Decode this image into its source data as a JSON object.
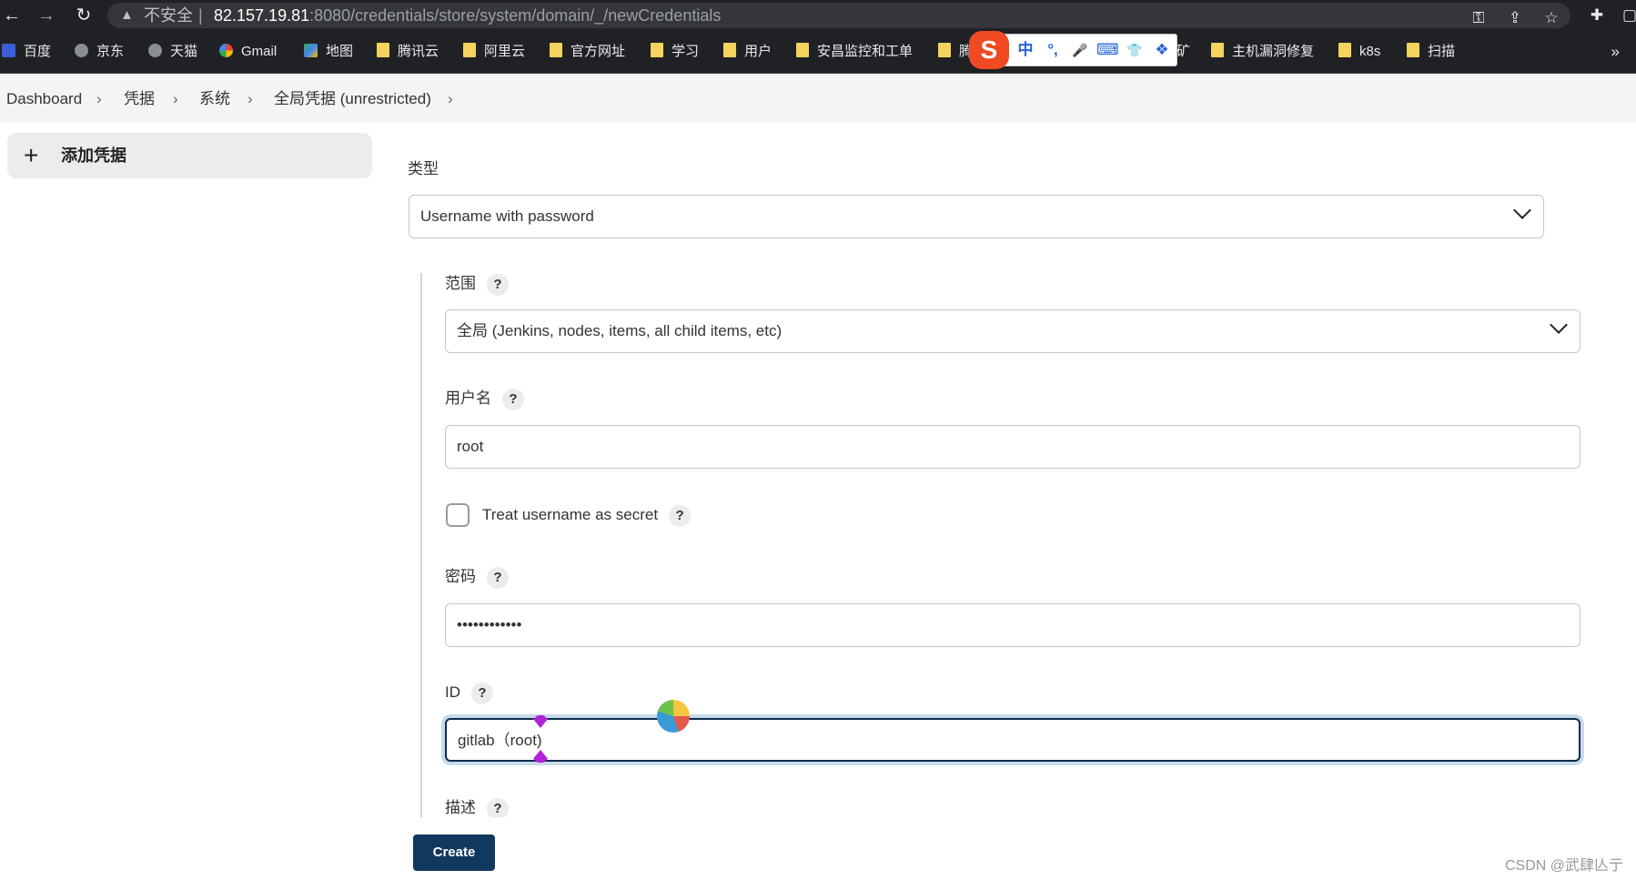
{
  "browser": {
    "url_warning": "不安全",
    "url_separator": "|",
    "url_host": "82.157.19.81",
    "url_path": ":8080/credentials/store/system/domain/_/newCredentials",
    "bookmarks": [
      "百度",
      "京东",
      "天猫",
      "Gmail",
      "地图",
      "腾讯云",
      "阿里云",
      "官方网址",
      "学习",
      "用户",
      "安昌监控和工单",
      "腾",
      "矿",
      "主机漏洞修复",
      "k8s",
      "扫描"
    ],
    "more": "»"
  },
  "ime": {
    "logo": "S",
    "items": [
      "中",
      "°,",
      "🎤",
      "⌨",
      "👕",
      "❖"
    ]
  },
  "breadcrumb": {
    "items": [
      "Dashboard",
      "凭据",
      "系统",
      "全局凭据 (unrestricted)"
    ]
  },
  "sidebar": {
    "add_credentials": "添加凭据"
  },
  "form": {
    "kind_label": "类型",
    "kind_value": "Username with password",
    "scope_label": "范围",
    "scope_value": "全局 (Jenkins, nodes, items, all child items, etc)",
    "username_label": "用户名",
    "username_value": "root",
    "treat_secret_label": "Treat username as secret",
    "password_label": "密码",
    "password_value": "••••••••••••",
    "id_label": "ID",
    "id_value": "gitlab（root)",
    "description_label": "描述",
    "help": "?"
  },
  "actions": {
    "create": "Create"
  },
  "watermark": "CSDN @武肆亾亍"
}
